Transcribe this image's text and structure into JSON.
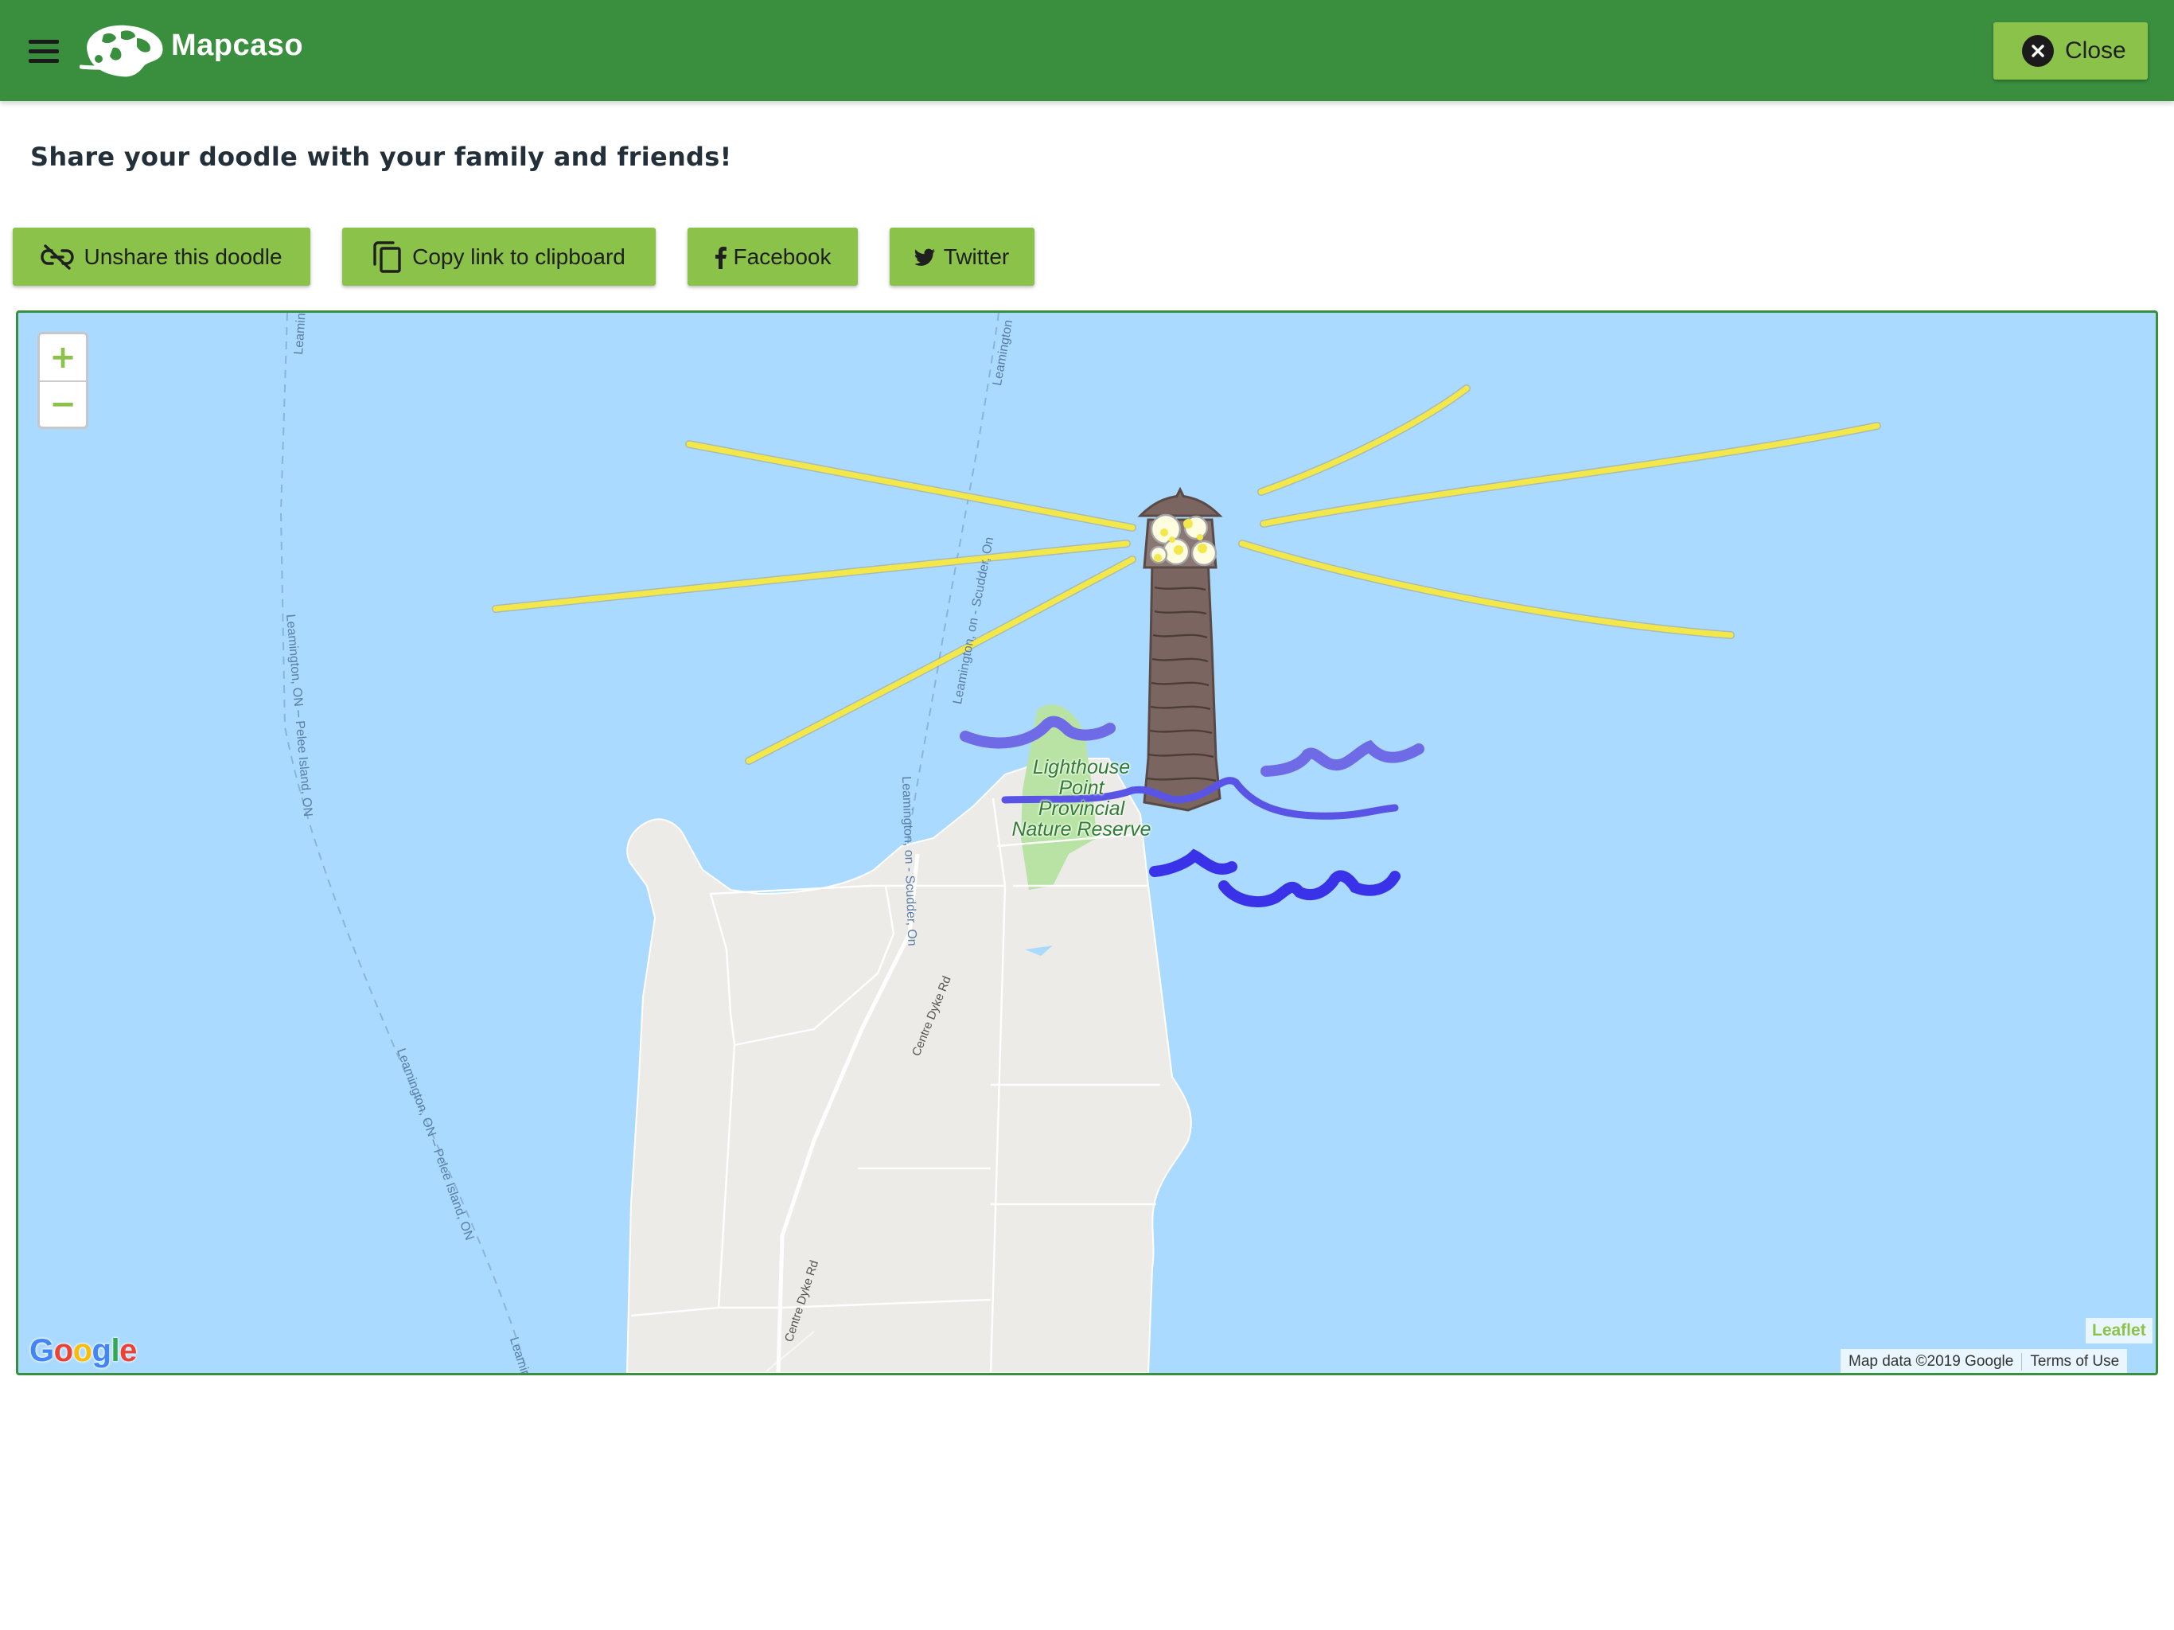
{
  "header": {
    "app_title": "Mapcaso",
    "close_label": "Close",
    "background": "#3a8f3e",
    "icons": {
      "menu": "hamburger-menu-icon",
      "logo": "palette-globe-logo-icon",
      "close": "close-circle-icon"
    }
  },
  "share": {
    "heading": "Share your doodle with your family and friends!"
  },
  "actions": {
    "unshare_label": "Unshare this doodle",
    "copy_label": "Copy link to clipboard",
    "facebook_label": "Facebook",
    "twitter_label": "Twitter",
    "button_color": "#8bc34a",
    "icons": {
      "unshare": "link-off-icon",
      "copy": "copy-icon",
      "facebook": "facebook-icon",
      "twitter": "twitter-icon"
    }
  },
  "map": {
    "zoom_in": "+",
    "zoom_out": "−",
    "place_label_line1": "Lighthouse",
    "place_label_line2": "Point",
    "place_label_line3": "Provincial",
    "place_label_line4": "Nature Reserve",
    "ferry_route_1": "Leamington, ON – Pelee Island, ON",
    "ferry_route_2": "Leamington, ON – Pelee Island, ON",
    "ferry_route_3": "Leamington, on - Scudder, On",
    "ferry_route_4": "Leamington, on - Scudder, On",
    "ferry_route_5": "Leamington",
    "ferry_route_6": "Leamington",
    "ferry_route_7": "Leamin",
    "road_label_1": "Centre Dyke Rd",
    "road_label_2": "Centre Dyke Rd",
    "google_logo": "Google",
    "leaflet_label": "Leaflet",
    "map_data": "Map data ©2019 Google",
    "terms": "Terms of Use",
    "water_color": "#aadaff",
    "land_color": "#ecebe8",
    "park_color": "#b9e3a4",
    "doodle_colors": {
      "rays": "#f3e84a",
      "tower": "#7a6561",
      "waves_light": "#6f6be6",
      "waves_dark": "#3a32e8"
    }
  }
}
